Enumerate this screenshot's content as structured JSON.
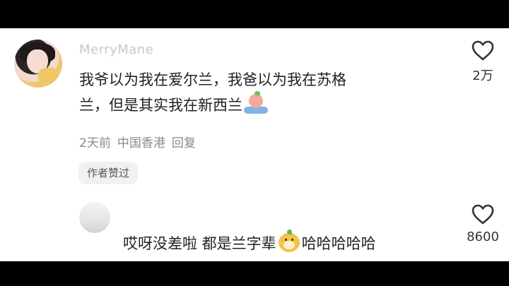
{
  "comment": {
    "username": "MerryMane",
    "text_line1": "我爷以为我在爱尔兰，我爸以为我在苏格",
    "text_line2": "兰，但是其实我在新西兰",
    "emoji": "crying-emoji",
    "time": "2天前",
    "location": "中国香港",
    "reply_label": "回复",
    "author_liked": "作者赞过",
    "like_count": "2万"
  },
  "reply": {
    "text_before_emoji": "哎呀没差啦 都是兰字辈",
    "emoji": "dog-emoji",
    "text_after_emoji": "哈哈哈哈哈",
    "like_count": "8600"
  },
  "colors": {
    "text_primary": "#222222",
    "text_secondary": "#8a8a8a",
    "badge_bg": "#f1f1f1",
    "heart_stroke": "#333333",
    "letterbox": "#000000"
  }
}
